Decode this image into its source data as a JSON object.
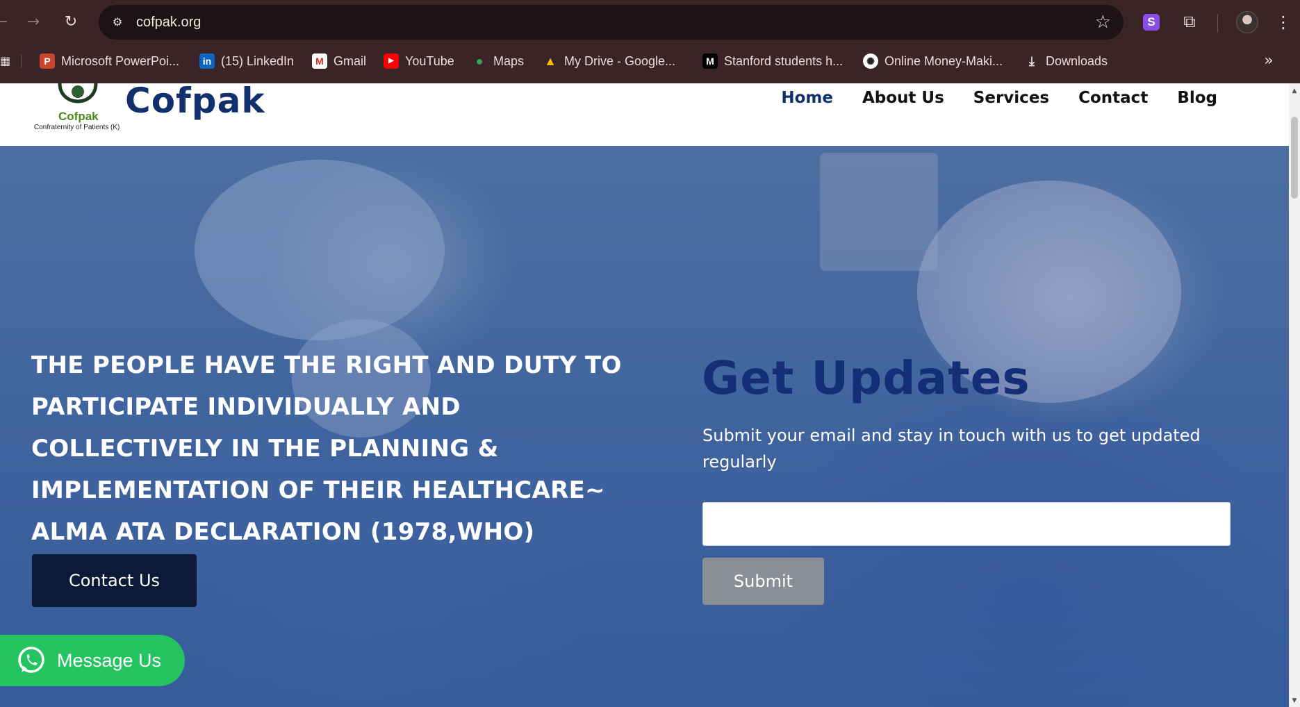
{
  "browser": {
    "url": "cofpak.org",
    "bookmarks": [
      {
        "label": "Microsoft PowerPoi...",
        "icon": "powerpoint-icon"
      },
      {
        "label": "(15) LinkedIn",
        "icon": "linkedin-icon"
      },
      {
        "label": "Gmail",
        "icon": "gmail-icon"
      },
      {
        "label": "YouTube",
        "icon": "youtube-icon"
      },
      {
        "label": "Maps",
        "icon": "maps-icon"
      },
      {
        "label": "My Drive - Google...",
        "icon": "google-drive-icon"
      },
      {
        "label": "Stanford students h...",
        "icon": "medium-icon"
      },
      {
        "label": "Online Money-Maki...",
        "icon": "chatgpt-icon"
      },
      {
        "label": "Downloads",
        "icon": "download-icon"
      }
    ],
    "extension_label": "S"
  },
  "site": {
    "logo_word": "Cofpak",
    "logo_tagline": "Confraternity of Patients (K)",
    "title": "Cofpak",
    "nav": [
      {
        "label": "Home",
        "active": true
      },
      {
        "label": "About Us",
        "active": false
      },
      {
        "label": "Services",
        "active": false
      },
      {
        "label": "Contact",
        "active": false
      },
      {
        "label": "Blog",
        "active": false
      }
    ]
  },
  "hero": {
    "quote": "THE PEOPLE HAVE THE RIGHT AND DUTY TO PARTICIPATE INDIVIDUALLY AND COLLECTIVELY IN THE PLANNING & IMPLEMENTATION OF THEIR HEALTHCARE~ ALMA ATA DECLARATION (1978,WHO)",
    "contact_button": "Contact Us",
    "updates_title": "Get Updates",
    "updates_text": "Submit your email and stay in touch  with us to get updated regularly",
    "email_value": "",
    "submit_button": "Submit",
    "whatsapp_button": "Message Us"
  },
  "colors": {
    "chrome_bg": "#3b2428",
    "brand_navy": "#12306b",
    "whatsapp_green": "#26c461",
    "contact_btn": "#0c1a3a",
    "submit_btn": "#8a8f97"
  }
}
